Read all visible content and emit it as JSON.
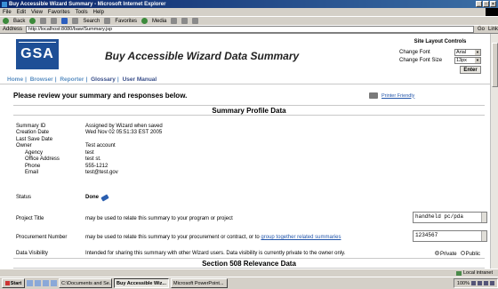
{
  "window": {
    "title": "Buy Accessible Wizard Summary - Microsoft Internet Explorer"
  },
  "menu": [
    "File",
    "Edit",
    "View",
    "Favorites",
    "Tools",
    "Help"
  ],
  "toolbar": {
    "back": "Back",
    "search": "Search",
    "favorites": "Favorites",
    "media": "Media"
  },
  "address": {
    "label": "Address",
    "url": "http://localhost:8080/baw/Summary.jsp",
    "go": "Go",
    "links": "Link"
  },
  "header": {
    "logo": "GSA",
    "title": "Buy Accessible Wizard Data Summary",
    "layout_controls": {
      "title": "Site Layout Controls",
      "font_label": "Change Font",
      "font_value": "Arial",
      "size_label": "Change Font Size",
      "size_value": "13px",
      "enter": "Enter"
    }
  },
  "nav": [
    "Home",
    "Browser",
    "Reporter",
    "Glossary",
    "User Manual"
  ],
  "main": {
    "review": "Please review your summary and responses below.",
    "printer_friendly": "Printer Friendly",
    "section1": "Summary Profile Data",
    "section2": "Section 508 Relevance Data",
    "fields": [
      {
        "label": "Summary ID",
        "value": "Assigned by Wizard when saved",
        "indent": false
      },
      {
        "label": "Creation Date",
        "value": "Wed Nov 02 05:51:33 EST 2005",
        "indent": false
      },
      {
        "label": "Last Save Date",
        "value": "",
        "indent": false
      },
      {
        "label": "Owner",
        "value": "Test account",
        "indent": false
      },
      {
        "label": "Agency",
        "value": "test",
        "indent": true
      },
      {
        "label": "Office Address",
        "value": "test st.",
        "indent": true
      },
      {
        "label": "Phone",
        "value": "555-1212",
        "indent": true
      },
      {
        "label": "Email",
        "value": "test@test.gov",
        "indent": true
      }
    ],
    "status": {
      "label": "Status",
      "value": "Done"
    },
    "project_title": {
      "label": "Project Title",
      "desc": "may be used to relate this summary to your program or project",
      "value": "handheld pc/pda"
    },
    "procurement": {
      "label": "Procurement Number",
      "desc": "may be used to relate this summary to your procurement or contract, or to",
      "link": "group together related summaries",
      "value": "1234567"
    },
    "visibility": {
      "label": "Data Visibility",
      "desc": "Intended for sharing this summary with other Wizard users. Data visibility is currently private to the owner only.",
      "private": "Private",
      "public": "Public"
    }
  },
  "statusbar": {
    "zone": "Local intranet"
  },
  "taskbar": {
    "start": "Start",
    "tasks": [
      "C:\\Documents and Se...",
      "Buy Accessible Wiz...",
      "Microsoft PowerPoint..."
    ],
    "zoom": "100%"
  }
}
